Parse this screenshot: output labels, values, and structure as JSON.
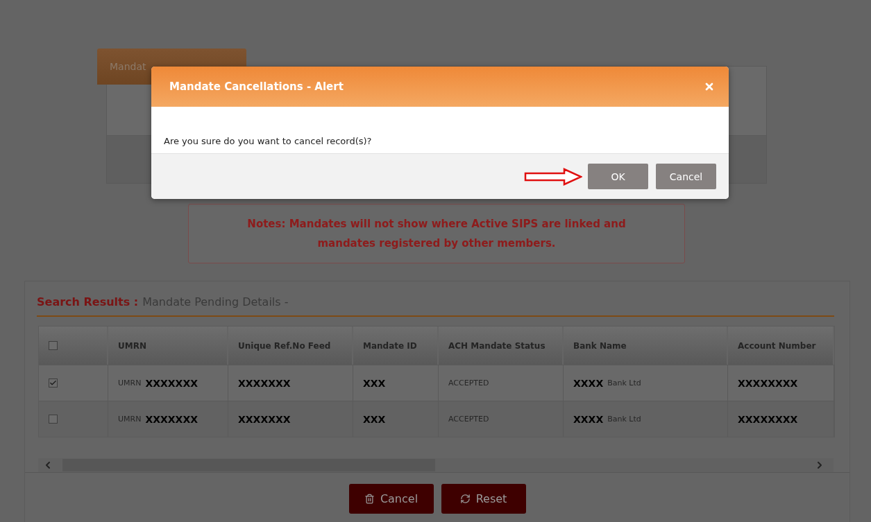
{
  "page_tab": {
    "label": "Mandat"
  },
  "notes": "Notes: Mandates will not show where Active SIPS are linked and mandates registered by other members.",
  "results": {
    "heading": "Search Results :",
    "subheading": "Mandate Pending Details -",
    "columns": [
      {
        "kind": "checkbox",
        "checked": false
      },
      {
        "kind": "text",
        "label": "UMRN"
      },
      {
        "kind": "text",
        "label": "Unique Ref.No Feed"
      },
      {
        "kind": "text",
        "label": "Mandate ID"
      },
      {
        "kind": "text",
        "label": "ACH Mandate Status"
      },
      {
        "kind": "text",
        "label": "Bank Name"
      },
      {
        "kind": "text",
        "label": "Account Number"
      }
    ],
    "rows": [
      {
        "checked": true,
        "umrn_prefix": "UMRN",
        "umrn": "XXXXXXX",
        "ref": "XXXXXXX",
        "mandate_id": "XXX",
        "status": "ACCEPTED",
        "bank_code": "XXXX",
        "bank_name": "Bank Ltd",
        "account": "XXXXXXXX"
      },
      {
        "checked": false,
        "umrn_prefix": "UMRN",
        "umrn": "XXXXXXX",
        "ref": "XXXXXXX",
        "mandate_id": "XXX",
        "status": "ACCEPTED",
        "bank_code": "XXXX",
        "bank_name": "Bank Ltd",
        "account": "XXXXXXXX"
      }
    ]
  },
  "actions": [
    {
      "kind": "delete",
      "label": "Cancel"
    },
    {
      "kind": "reset",
      "label": "Reset"
    }
  ],
  "dialog": {
    "title": "Mandate Cancellations - Alert",
    "message": "Are you sure do you want to cancel record(s)?",
    "buttons": [
      "OK",
      "Cancel"
    ]
  }
}
